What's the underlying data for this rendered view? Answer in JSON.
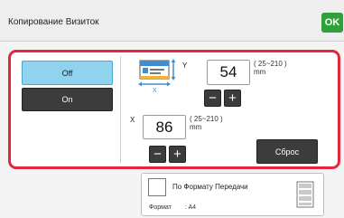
{
  "header": {
    "title": "Копирование Визиток",
    "ok_label": "OK"
  },
  "mode": {
    "off_label": "Off",
    "on_label": "On",
    "selected": "Off"
  },
  "dimensions": {
    "y_axis_label": "Y",
    "y_value": "54",
    "y_range": "( 25~210 )",
    "y_unit": "mm",
    "x_axis_label": "X",
    "x_value": "86",
    "x_range": "( 25~210 )",
    "x_unit": "mm",
    "minus_label": "−",
    "plus_label": "+",
    "reset_label": "Сброс"
  },
  "settings": {
    "checkbox_label": "По Формату Передачи",
    "checked": false,
    "format_label": "Формат",
    "format_value": ":  A4"
  },
  "colors": {
    "accent_red": "#e3283d",
    "ok_green": "#2fa13a",
    "selected_blue": "#8fd3ee",
    "button_dark": "#3c3c3c"
  },
  "icons": [
    "business-card-size-icon",
    "paper-sheet-icon"
  ]
}
